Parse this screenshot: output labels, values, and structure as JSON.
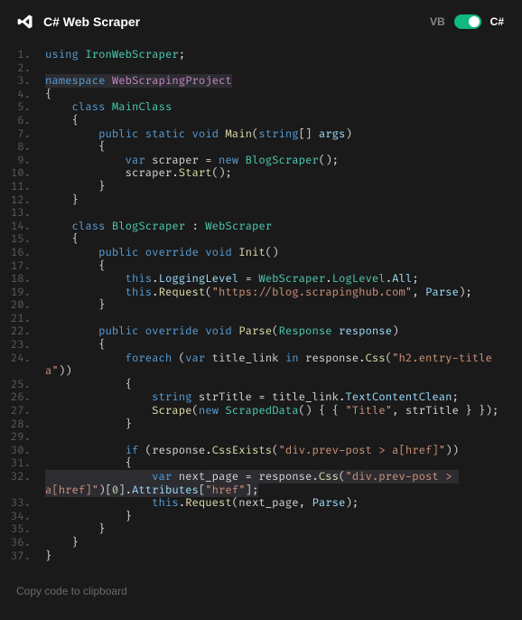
{
  "header": {
    "title": "C# Web Scraper",
    "lang_left": "VB",
    "lang_right": "C#",
    "active_lang": "C#"
  },
  "footer": {
    "copy_label": "Copy code to clipboard"
  },
  "code": {
    "lines": [
      {
        "n": 1,
        "t": [
          [
            "kw",
            "using"
          ],
          [
            "pln",
            " "
          ],
          [
            "cls",
            "IronWebScraper"
          ],
          [
            "pun",
            ";"
          ]
        ]
      },
      {
        "n": 2,
        "t": []
      },
      {
        "n": 3,
        "hl": true,
        "t": [
          [
            "kw",
            "namespace"
          ],
          [
            "pln",
            " "
          ],
          [
            "nsp",
            "WebScrapingProject"
          ]
        ]
      },
      {
        "n": 4,
        "t": [
          [
            "pun",
            "{"
          ]
        ]
      },
      {
        "n": 5,
        "t": [
          [
            "pln",
            "    "
          ],
          [
            "kw",
            "class"
          ],
          [
            "pln",
            " "
          ],
          [
            "cls",
            "MainClass"
          ]
        ]
      },
      {
        "n": 6,
        "t": [
          [
            "pln",
            "    "
          ],
          [
            "pun",
            "{"
          ]
        ]
      },
      {
        "n": 7,
        "t": [
          [
            "pln",
            "        "
          ],
          [
            "kw",
            "public"
          ],
          [
            "pln",
            " "
          ],
          [
            "kw",
            "static"
          ],
          [
            "pln",
            " "
          ],
          [
            "kw",
            "void"
          ],
          [
            "pln",
            " "
          ],
          [
            "mth",
            "Main"
          ],
          [
            "pun",
            "("
          ],
          [
            "kw",
            "string"
          ],
          [
            "pun",
            "[]"
          ],
          [
            "pln",
            " "
          ],
          [
            "prm",
            "args"
          ],
          [
            "pun",
            ")"
          ]
        ]
      },
      {
        "n": 8,
        "t": [
          [
            "pln",
            "        "
          ],
          [
            "pun",
            "{"
          ]
        ]
      },
      {
        "n": 9,
        "t": [
          [
            "pln",
            "            "
          ],
          [
            "kw",
            "var"
          ],
          [
            "pln",
            " scraper "
          ],
          [
            "pun",
            "="
          ],
          [
            "pln",
            " "
          ],
          [
            "kw",
            "new"
          ],
          [
            "pln",
            " "
          ],
          [
            "cls",
            "BlogScraper"
          ],
          [
            "pun",
            "();"
          ]
        ]
      },
      {
        "n": 10,
        "t": [
          [
            "pln",
            "            scraper"
          ],
          [
            "pun",
            "."
          ],
          [
            "mth",
            "Start"
          ],
          [
            "pun",
            "();"
          ]
        ]
      },
      {
        "n": 11,
        "t": [
          [
            "pln",
            "        "
          ],
          [
            "pun",
            "}"
          ]
        ]
      },
      {
        "n": 12,
        "t": [
          [
            "pln",
            "    "
          ],
          [
            "pun",
            "}"
          ]
        ]
      },
      {
        "n": 13,
        "t": []
      },
      {
        "n": 14,
        "t": [
          [
            "pln",
            "    "
          ],
          [
            "kw",
            "class"
          ],
          [
            "pln",
            " "
          ],
          [
            "cls",
            "BlogScraper"
          ],
          [
            "pln",
            " "
          ],
          [
            "pun",
            ":"
          ],
          [
            "pln",
            " "
          ],
          [
            "cls",
            "WebScraper"
          ]
        ]
      },
      {
        "n": 15,
        "t": [
          [
            "pln",
            "    "
          ],
          [
            "pun",
            "{"
          ]
        ]
      },
      {
        "n": 16,
        "t": [
          [
            "pln",
            "        "
          ],
          [
            "kw",
            "public"
          ],
          [
            "pln",
            " "
          ],
          [
            "kw",
            "override"
          ],
          [
            "pln",
            " "
          ],
          [
            "kw",
            "void"
          ],
          [
            "pln",
            " "
          ],
          [
            "mth",
            "Init"
          ],
          [
            "pun",
            "()"
          ]
        ]
      },
      {
        "n": 17,
        "t": [
          [
            "pln",
            "        "
          ],
          [
            "pun",
            "{"
          ]
        ]
      },
      {
        "n": 18,
        "t": [
          [
            "pln",
            "            "
          ],
          [
            "kw",
            "this"
          ],
          [
            "pun",
            "."
          ],
          [
            "prm",
            "LoggingLevel"
          ],
          [
            "pln",
            " "
          ],
          [
            "pun",
            "="
          ],
          [
            "pln",
            " "
          ],
          [
            "cls",
            "WebScraper"
          ],
          [
            "pun",
            "."
          ],
          [
            "cls",
            "LogLevel"
          ],
          [
            "pun",
            "."
          ],
          [
            "prm",
            "All"
          ],
          [
            "pun",
            ";"
          ]
        ]
      },
      {
        "n": 19,
        "t": [
          [
            "pln",
            "            "
          ],
          [
            "kw",
            "this"
          ],
          [
            "pun",
            "."
          ],
          [
            "mth",
            "Request"
          ],
          [
            "pun",
            "("
          ],
          [
            "str",
            "\"https://blog.scrapinghub.com\""
          ],
          [
            "pun",
            ", "
          ],
          [
            "prm",
            "Parse"
          ],
          [
            "pun",
            ");"
          ]
        ]
      },
      {
        "n": 20,
        "t": [
          [
            "pln",
            "        "
          ],
          [
            "pun",
            "}"
          ]
        ]
      },
      {
        "n": 21,
        "t": []
      },
      {
        "n": 22,
        "t": [
          [
            "pln",
            "        "
          ],
          [
            "kw",
            "public"
          ],
          [
            "pln",
            " "
          ],
          [
            "kw",
            "override"
          ],
          [
            "pln",
            " "
          ],
          [
            "kw",
            "void"
          ],
          [
            "pln",
            " "
          ],
          [
            "mth",
            "Parse"
          ],
          [
            "pun",
            "("
          ],
          [
            "cls",
            "Response"
          ],
          [
            "pln",
            " "
          ],
          [
            "prm",
            "response"
          ],
          [
            "pun",
            ")"
          ]
        ]
      },
      {
        "n": 23,
        "t": [
          [
            "pln",
            "        "
          ],
          [
            "pun",
            "{"
          ]
        ]
      },
      {
        "n": 24,
        "t": [
          [
            "pln",
            "            "
          ],
          [
            "kw",
            "foreach"
          ],
          [
            "pln",
            " "
          ],
          [
            "pun",
            "("
          ],
          [
            "kw",
            "var"
          ],
          [
            "pln",
            " title_link "
          ],
          [
            "kw",
            "in"
          ],
          [
            "pln",
            " response"
          ],
          [
            "pun",
            "."
          ],
          [
            "mth",
            "Css"
          ],
          [
            "pun",
            "("
          ],
          [
            "str",
            "\"h2.entry-title a\""
          ],
          [
            "pun",
            "))"
          ]
        ]
      },
      {
        "n": 25,
        "t": [
          [
            "pln",
            "            "
          ],
          [
            "pun",
            "{"
          ]
        ]
      },
      {
        "n": 26,
        "t": [
          [
            "pln",
            "                "
          ],
          [
            "kw",
            "string"
          ],
          [
            "pln",
            " strTitle "
          ],
          [
            "pun",
            "="
          ],
          [
            "pln",
            " title_link"
          ],
          [
            "pun",
            "."
          ],
          [
            "prm",
            "TextContentClean"
          ],
          [
            "pun",
            ";"
          ]
        ]
      },
      {
        "n": 27,
        "t": [
          [
            "pln",
            "                "
          ],
          [
            "mth",
            "Scrape"
          ],
          [
            "pun",
            "("
          ],
          [
            "kw",
            "new"
          ],
          [
            "pln",
            " "
          ],
          [
            "cls",
            "ScrapedData"
          ],
          [
            "pun",
            "() { { "
          ],
          [
            "str",
            "\"Title\""
          ],
          [
            "pun",
            ", strTitle } });"
          ]
        ]
      },
      {
        "n": 28,
        "t": [
          [
            "pln",
            "            "
          ],
          [
            "pun",
            "}"
          ]
        ]
      },
      {
        "n": 29,
        "t": []
      },
      {
        "n": 30,
        "t": [
          [
            "pln",
            "            "
          ],
          [
            "kw",
            "if"
          ],
          [
            "pln",
            " "
          ],
          [
            "pun",
            "("
          ],
          [
            "pln",
            "response"
          ],
          [
            "pun",
            "."
          ],
          [
            "mth",
            "CssExists"
          ],
          [
            "pun",
            "("
          ],
          [
            "str",
            "\"div.prev-post > a[href]\""
          ],
          [
            "pun",
            "))"
          ]
        ]
      },
      {
        "n": 31,
        "t": [
          [
            "pln",
            "            "
          ],
          [
            "pun",
            "{"
          ]
        ]
      },
      {
        "n": 32,
        "hl": true,
        "t": [
          [
            "pln",
            "                "
          ],
          [
            "kw",
            "var"
          ],
          [
            "pln",
            " next_page "
          ],
          [
            "pun",
            "="
          ],
          [
            "pln",
            " response"
          ],
          [
            "pun",
            "."
          ],
          [
            "mth",
            "Css"
          ],
          [
            "pun",
            "("
          ],
          [
            "str",
            "\"div.prev-post > a[href]\""
          ],
          [
            "pun",
            ")["
          ],
          [
            "num",
            "0"
          ],
          [
            "pun",
            "]."
          ],
          [
            "prm",
            "Attributes"
          ],
          [
            "pun",
            "["
          ],
          [
            "str",
            "\"href\""
          ],
          [
            "pun",
            "];"
          ]
        ]
      },
      {
        "n": 33,
        "t": [
          [
            "pln",
            "                "
          ],
          [
            "kw",
            "this"
          ],
          [
            "pun",
            "."
          ],
          [
            "mth",
            "Request"
          ],
          [
            "pun",
            "("
          ],
          [
            "pln",
            "next_page"
          ],
          [
            "pun",
            ", "
          ],
          [
            "prm",
            "Parse"
          ],
          [
            "pun",
            ");"
          ]
        ]
      },
      {
        "n": 34,
        "t": [
          [
            "pln",
            "            "
          ],
          [
            "pun",
            "}"
          ]
        ]
      },
      {
        "n": 35,
        "t": [
          [
            "pln",
            "        "
          ],
          [
            "pun",
            "}"
          ]
        ]
      },
      {
        "n": 36,
        "t": [
          [
            "pln",
            "    "
          ],
          [
            "pun",
            "}"
          ]
        ]
      },
      {
        "n": 37,
        "t": [
          [
            "pun",
            "}"
          ]
        ]
      }
    ]
  }
}
